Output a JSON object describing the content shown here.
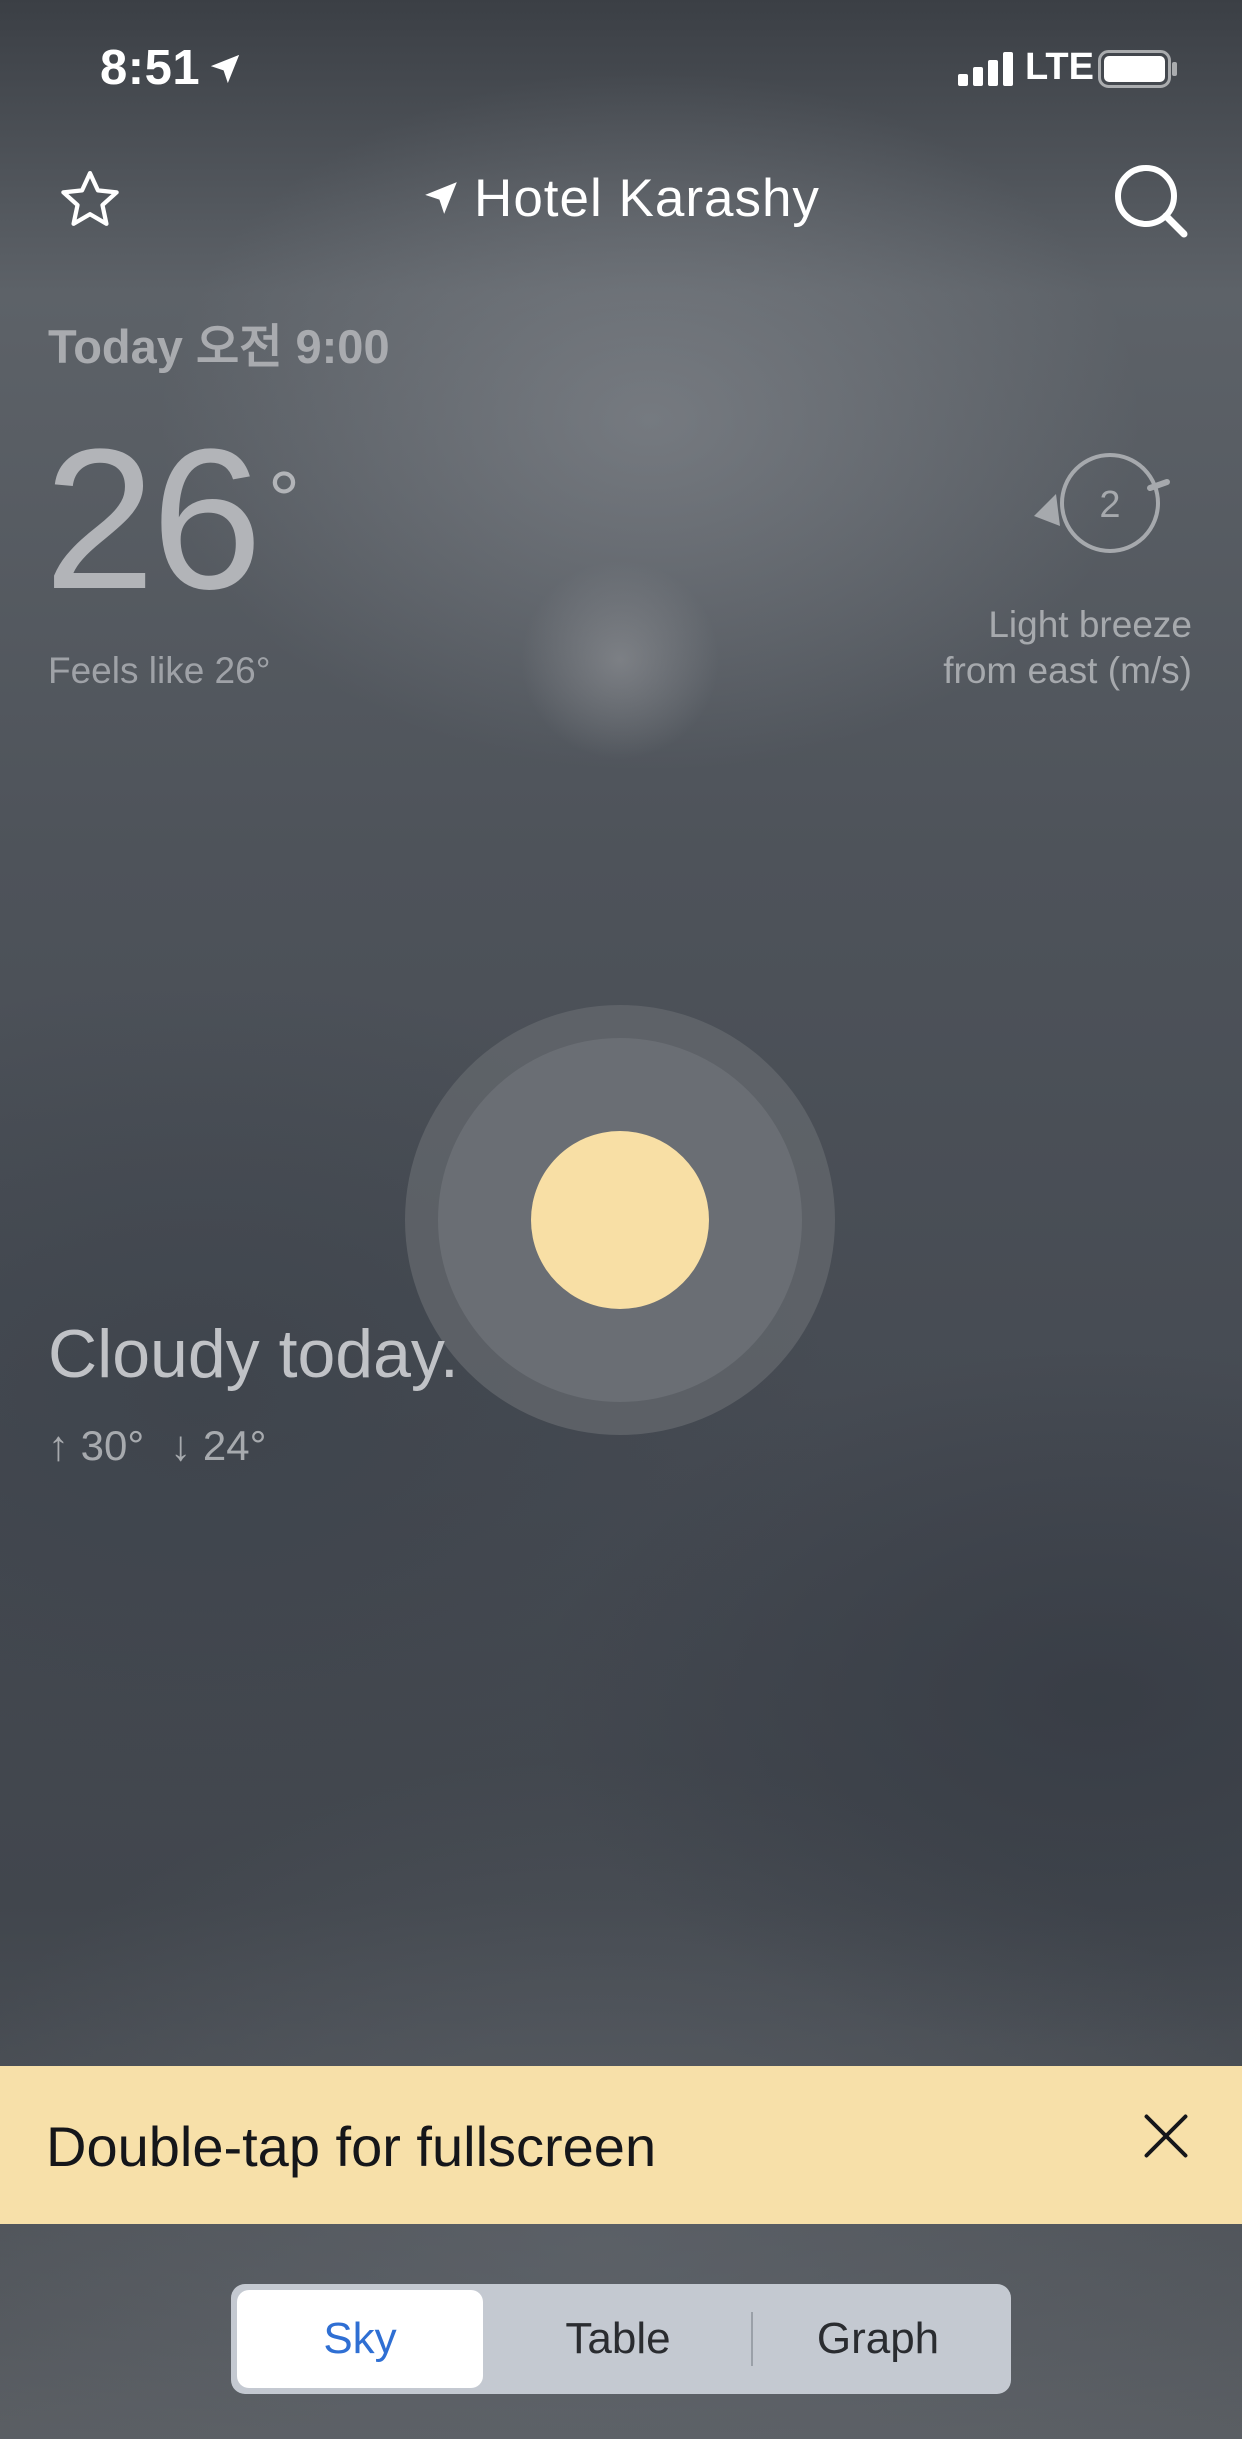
{
  "status_bar": {
    "time": "8:51",
    "network": "LTE"
  },
  "header": {
    "location": "Hotel Karashy"
  },
  "current": {
    "datetime": "Today 오전 9:00",
    "temperature": "26",
    "degree_symbol": "°",
    "feels_like": "Feels like 26°"
  },
  "wind": {
    "speed": "2",
    "line1": "Light breeze",
    "line2": "from east (m/s)"
  },
  "forecast": {
    "condition": "Cloudy today.",
    "high": "↑ 30°",
    "low": "↓ 24°"
  },
  "banner": {
    "text": "Double-tap for fullscreen"
  },
  "tabs": [
    {
      "label": "Sky",
      "selected": true
    },
    {
      "label": "Table",
      "selected": false
    },
    {
      "label": "Graph",
      "selected": false
    }
  ],
  "colors": {
    "sun": "#f8dfa5",
    "banner": "#f7e0a9",
    "accent": "#2f6fd3"
  }
}
